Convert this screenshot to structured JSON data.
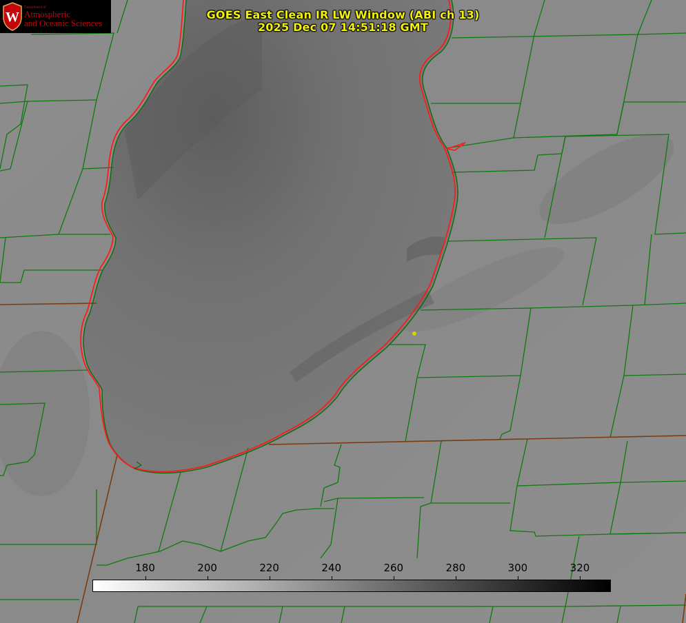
{
  "title": {
    "line1": "GOES East Clean IR LW Window (ABI ch 13)",
    "line2": "2025 Dec 07 14:51:18 GMT"
  },
  "logo": {
    "department": "Department of",
    "line1": "Atmospheric",
    "line2": "and Oceanic Sciences",
    "shield_letter": "W",
    "color": "#c5050c"
  },
  "colorbar": {
    "min": 163,
    "max": 330,
    "gradient_from": "#ffffff",
    "gradient_to": "#000000",
    "ticks": [
      180,
      200,
      220,
      240,
      260,
      280,
      300,
      320
    ],
    "tick_labels": [
      "180",
      "200",
      "220",
      "240",
      "260",
      "280",
      "300",
      "320"
    ]
  },
  "map": {
    "boundary_color": "#0d7a0d",
    "state_border_color": "#7a3b10",
    "lake_outline_color": "#ff1a1a",
    "marker_color": "#e0d000",
    "lake_name_icon": "lake-michigan-shape",
    "marker_icon": "location-dot-icon"
  }
}
